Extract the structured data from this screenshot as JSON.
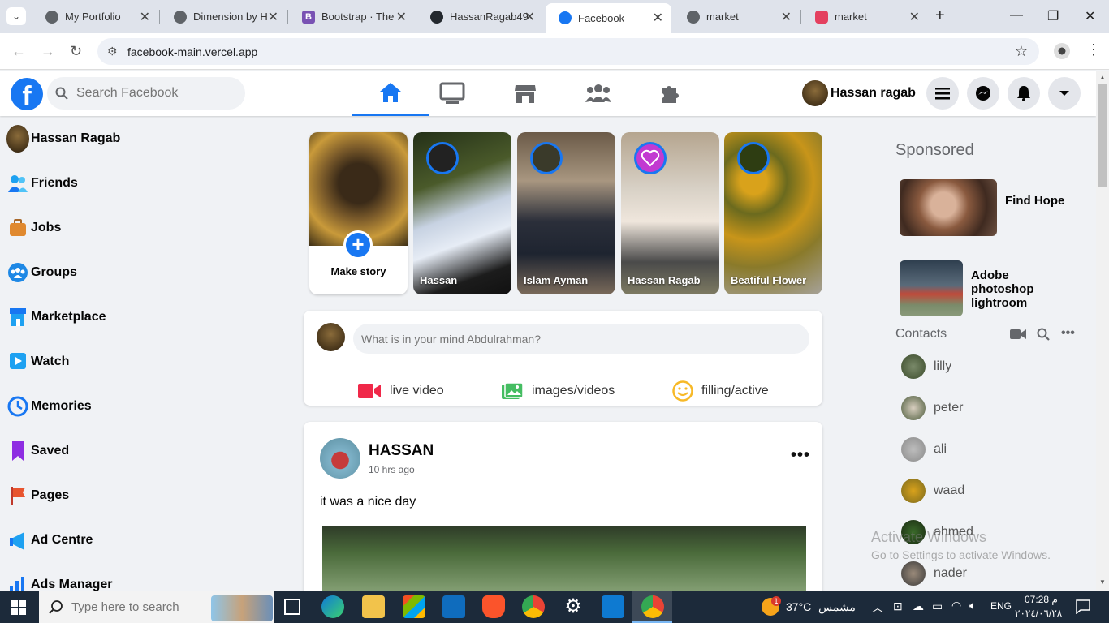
{
  "browser": {
    "tabs": [
      {
        "label": "My Portfolio",
        "icon": "globe-icon",
        "active": false
      },
      {
        "label": "Dimension by H",
        "icon": "globe-icon",
        "active": false
      },
      {
        "label": "Bootstrap · The",
        "icon": "bootstrap-icon",
        "active": false
      },
      {
        "label": "HassanRagab49",
        "icon": "github-icon",
        "active": false
      },
      {
        "label": "Facebook",
        "icon": "facebook-icon",
        "active": true
      },
      {
        "label": "market",
        "icon": "globe-icon",
        "active": false
      },
      {
        "label": "market",
        "icon": "app-icon",
        "active": false
      }
    ],
    "url": "facebook-main.vercel.app"
  },
  "header": {
    "search_placeholder": "Search Facebook",
    "profile_name": "Hassan ragab",
    "accent": "#1877f2"
  },
  "sidebar": {
    "items": [
      {
        "label": "Hassan Ragab",
        "icon": "avatar"
      },
      {
        "label": "Friends",
        "icon": "friends-icon"
      },
      {
        "label": "Jobs",
        "icon": "briefcase-icon"
      },
      {
        "label": "Groups",
        "icon": "groups-icon"
      },
      {
        "label": "Marketplace",
        "icon": "store-icon"
      },
      {
        "label": "Watch",
        "icon": "play-icon"
      },
      {
        "label": "Memories",
        "icon": "clock-icon"
      },
      {
        "label": "Saved",
        "icon": "bookmark-icon"
      },
      {
        "label": "Pages",
        "icon": "flag-icon"
      },
      {
        "label": "Ad Centre",
        "icon": "megaphone-icon"
      },
      {
        "label": "Ads Manager",
        "icon": "chart-icon"
      }
    ]
  },
  "stories": {
    "make_story_label": "Make story",
    "items": [
      {
        "name": "Hassan"
      },
      {
        "name": "Islam Ayman"
      },
      {
        "name": "Hassan Ragab"
      },
      {
        "name": "Beatiful Flower"
      }
    ]
  },
  "composer": {
    "placeholder": "What is in your mind Abdulrahman?",
    "actions": [
      {
        "label": "live video",
        "icon": "video-icon"
      },
      {
        "label": "images/videos",
        "icon": "photo-icon"
      },
      {
        "label": "filling/active",
        "icon": "smile-icon"
      }
    ]
  },
  "post": {
    "author": "HASSAN",
    "time": "10 hrs ago",
    "text": "it was a nice day",
    "more": "•••"
  },
  "right": {
    "sponsored_title": "Sponsored",
    "ads": [
      {
        "title": "Find Hope"
      },
      {
        "title": "Adobe photoshop lightroom"
      }
    ],
    "contacts_title": "Contacts",
    "contacts": [
      {
        "name": "lilly"
      },
      {
        "name": "peter"
      },
      {
        "name": "ali"
      },
      {
        "name": "waad"
      },
      {
        "name": "ahmed"
      },
      {
        "name": "nader"
      }
    ]
  },
  "watermark": {
    "line1": "Activate Windows",
    "line2": "Go to Settings to activate Windows."
  },
  "taskbar": {
    "search_placeholder": "Type here to search",
    "weather_temp": "37°C",
    "weather_text": "مشمس",
    "weather_badge": "1",
    "lang": "ENG",
    "time": "07:28 م",
    "date": "٢٠٢٤/٠٦/٢٨"
  }
}
